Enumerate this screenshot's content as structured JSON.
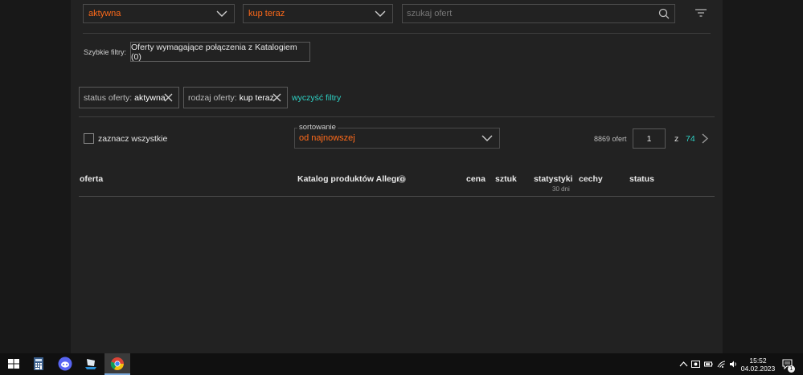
{
  "filters": {
    "status_value": "aktywna",
    "type_value": "kup teraz",
    "search_placeholder": "szukaj ofert"
  },
  "quick_filters": {
    "label": "Szybkie filtry:",
    "chip": "Oferty wymagające połączenia z Katalogiem (0)"
  },
  "active_filters": [
    {
      "key": "status oferty:",
      "value": "aktywna"
    },
    {
      "key": "rodzaj oferty:",
      "value": "kup teraz"
    }
  ],
  "clear_filters": "wyczyść filtry",
  "select_all": "zaznacz wszystkie",
  "sorting": {
    "legend": "sortowanie",
    "value": "od najnowszej"
  },
  "pagination": {
    "count": "8869 ofert",
    "current": "1",
    "of": "z",
    "total": "74"
  },
  "table": {
    "columns": {
      "offer": "oferta",
      "catalog": "Katalog produktów Allegro",
      "price": "cena",
      "qty": "sztuk",
      "stats": "statystyki",
      "stats_sub": "30 dni",
      "features": "cechy",
      "status": "status"
    }
  },
  "taskbar": {
    "time": "15:52",
    "date": "04.02.2023",
    "notifications": "1"
  },
  "colors": {
    "accent_orange": "#ff5a00",
    "accent_teal": "#2ed3c6",
    "panel_bg": "#222222",
    "page_bg": "#181818"
  }
}
